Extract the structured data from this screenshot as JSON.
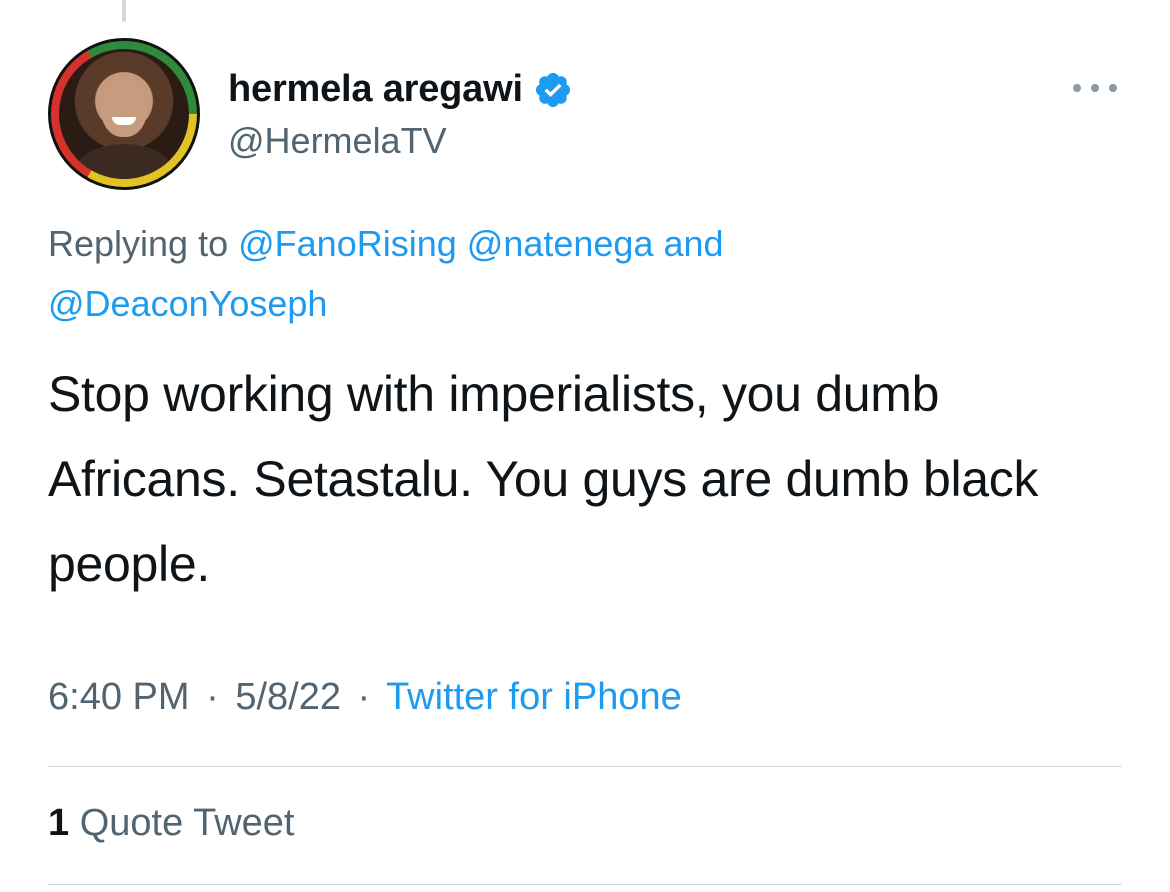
{
  "colors": {
    "accent": "#1d9bf0",
    "text_primary": "#0f1419",
    "text_secondary": "#536471",
    "divider": "#cfd9de"
  },
  "tweet": {
    "author": {
      "display_name": "hermela aregawi",
      "handle": "@HermelaTV",
      "verified": true,
      "avatar_icon": "profile-photo"
    },
    "reply_context": {
      "prefix": "Replying to",
      "mentions": [
        "@FanoRising",
        "@natenega",
        "@DeaconYoseph"
      ],
      "conjunction": "and"
    },
    "text": "Stop working with imperialists, you dumb Africans. Setastalu. You guys are dumb black people.",
    "meta": {
      "time": "6:40 PM",
      "separator": "·",
      "date": "5/8/22",
      "source": "Twitter for iPhone"
    },
    "stats": {
      "quote_count": "1",
      "quote_label": "Quote Tweet"
    }
  }
}
